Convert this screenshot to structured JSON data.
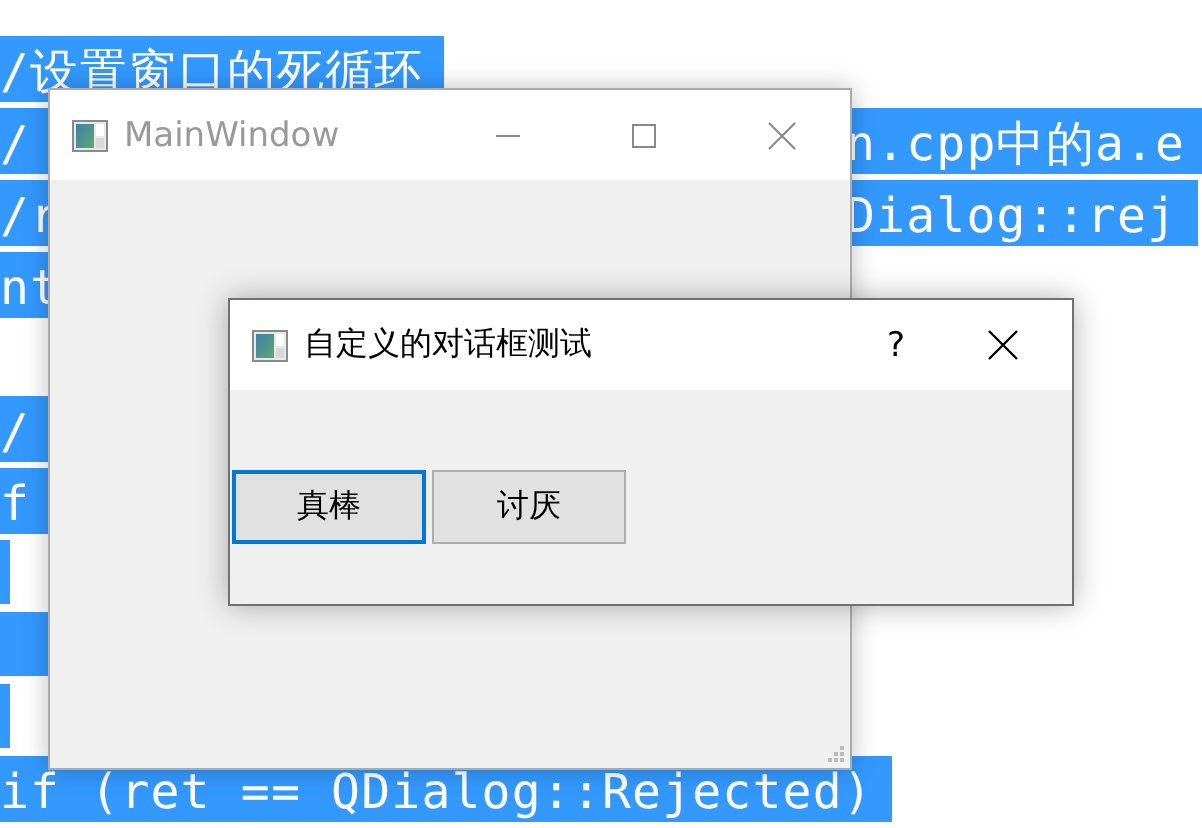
{
  "code_lines": [
    {
      "selected": true,
      "kind": "text",
      "segments": [
        "/设置窗口的死循环"
      ]
    },
    {
      "selected": true,
      "kind": "text",
      "segments": [
        "/",
        "n.cpp中的a.e"
      ]
    },
    {
      "selected": true,
      "kind": "text",
      "segments": [
        "/r",
        "Dialog::rej"
      ]
    },
    {
      "selected": true,
      "kind": "text",
      "segments": [
        "nt"
      ]
    },
    {
      "kind": "empty"
    },
    {
      "selected": true,
      "kind": "text",
      "segments": [
        "/"
      ]
    },
    {
      "selected": true,
      "kind": "text",
      "segments": [
        "f"
      ]
    },
    {
      "selected": true,
      "kind": "empty"
    },
    {
      "selected": true,
      "kind": "covered"
    },
    {
      "selected": true,
      "kind": "empty"
    },
    {
      "selected": true,
      "kind": "text",
      "segments": [
        "if (ret == QDialog::Rejected)"
      ]
    }
  ],
  "main_window": {
    "title": "MainWindow",
    "active": false
  },
  "dialog": {
    "title": "自定义的对话框测试",
    "help": "?",
    "active": true,
    "buttons": [
      {
        "label": "真棒",
        "focused": true
      },
      {
        "label": "讨厌",
        "focused": false
      }
    ]
  }
}
